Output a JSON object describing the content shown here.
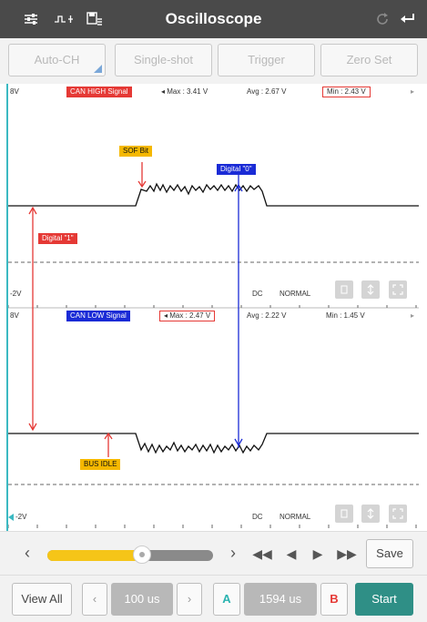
{
  "header": {
    "title": "Oscilloscope",
    "icons": [
      "sliders-icon",
      "signal-mode-icon",
      "save-list-icon",
      "refresh-icon",
      "back-icon"
    ]
  },
  "toolbar": {
    "auto_ch": "Auto-CH",
    "single_shot": "Single-shot",
    "trigger": "Trigger",
    "zero_set": "Zero Set"
  },
  "channel1": {
    "top_label": "8V",
    "bottom_label": "-2V",
    "signal_name": "CAN HIGH Signal",
    "max": "Max : 3.41 V",
    "avg": "Avg : 2.67 V",
    "min": "Min : 2.43 V",
    "coupling": "DC",
    "mode": "NORMAL",
    "sof_label": "SOF Bit",
    "digital0_label": "Digital \"0\"",
    "digital1_label": "Digital \"1\"",
    "color": "#e53935"
  },
  "channel2": {
    "top_label": "8V",
    "bottom_label": "-2V",
    "signal_name": "CAN LOW Signal",
    "max": "Max : 2.47 V",
    "avg": "Avg : 2.22 V",
    "min": "Min : 1.45 V",
    "coupling": "DC",
    "mode": "NORMAL",
    "bus_idle_label": "BUS IDLE",
    "color": "#1a2bd6"
  },
  "controls": {
    "slider_percent": 57,
    "save_label": "Save",
    "view_all_label": "View All",
    "time_div": "100 us",
    "cursor_a_label": "A",
    "cursor_delta": "1594 us",
    "cursor_b_label": "B",
    "start_label": "Start"
  },
  "colors": {
    "topbar": "#4a4a4a",
    "accent_start": "#2f8f86",
    "slider_fill": "#f5c518",
    "annotation_yellow": "#f5b800"
  }
}
